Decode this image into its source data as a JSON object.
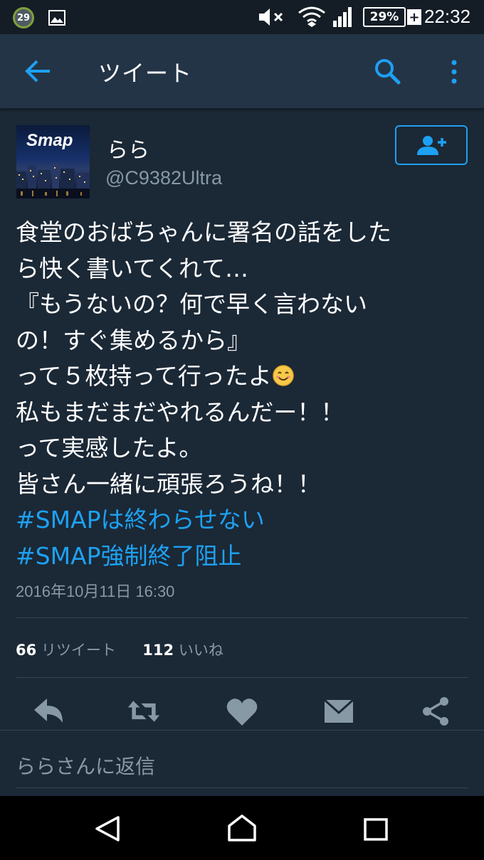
{
  "status_bar": {
    "notification_count": "29",
    "battery": "29%",
    "battery_charging": "+",
    "time": "22:32",
    "icons": [
      "notification-badge-icon",
      "photo-icon",
      "mute-icon",
      "wifi-icon",
      "signal-icon",
      "battery-icon"
    ]
  },
  "app_bar": {
    "title": "ツイート",
    "icons": [
      "back-arrow-icon",
      "search-icon",
      "more-vert-icon"
    ]
  },
  "tweet": {
    "avatar_text": "Smap",
    "display_name": "らら",
    "handle": "@C9382Ultra",
    "follow_icon": "add-user-icon",
    "lines": [
      "食堂のおばちゃんに署名の話をした",
      "ら快く書いてくれて…",
      "『もうないの？何で早く言わない",
      "の！すぐ集めるから』",
      "って５枚持って行ったよ",
      "私もまだまだやれるんだー！！",
      "って実感したよ。",
      "皆さん一緒に頑張ろうね！！"
    ],
    "emoji": "smiling-face-icon",
    "hashtags": [
      "#SMAPは終わらせない",
      "#SMAP強制終了阻止"
    ],
    "timestamp": "2016年10月11日 16:30",
    "retweet_count": "66",
    "retweet_label": "リツイート",
    "like_count": "112",
    "like_label": "いいね"
  },
  "actions": [
    "reply-icon",
    "retweet-icon",
    "heart-icon",
    "mail-icon",
    "share-icon"
  ],
  "reply_placeholder": "ららさんに返信",
  "nav_bar": {
    "icons": [
      "nav-back-icon",
      "nav-home-icon",
      "nav-recent-icon"
    ]
  },
  "colors": {
    "background": "#1b2836",
    "app_bar": "#243447",
    "accent": "#1da1f2",
    "secondary_text": "#8899a6"
  }
}
